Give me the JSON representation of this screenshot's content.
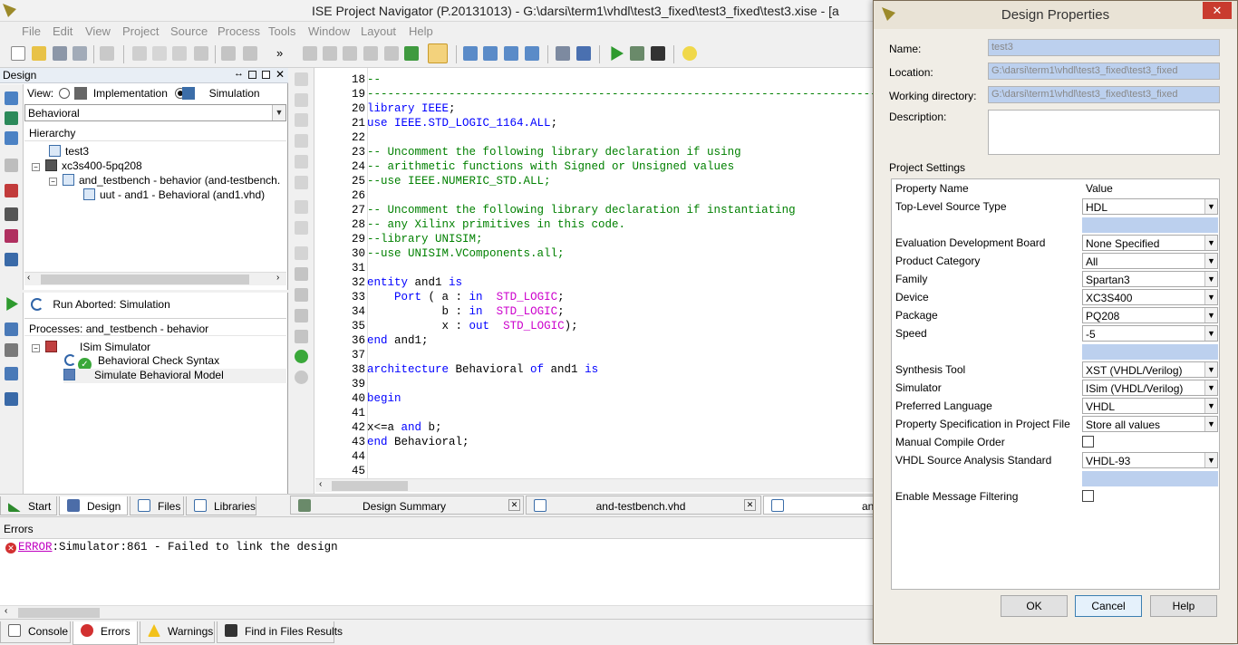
{
  "window": {
    "title": "ISE Project Navigator (P.20131013) - G:\\darsi\\term1\\vhdl\\test3_fixed\\test3_fixed\\test3.xise - [a"
  },
  "menu": [
    "File",
    "Edit",
    "View",
    "Project",
    "Source",
    "Process",
    "Tools",
    "Window",
    "Layout",
    "Help"
  ],
  "design_panel": {
    "title": "Design",
    "view_label": "View:",
    "impl_label": "Implementation",
    "sim_label": "Simulation",
    "selected_view": "Simulation",
    "behavior_combo": "Behavioral",
    "hierarchy_title": "Hierarchy",
    "tree": [
      "test3",
      "xc3s400-5pq208",
      "and_testbench - behavior (and-testbench.",
      "uut - and1 - Behavioral (and1.vhd)"
    ]
  },
  "process_panel": {
    "status": "Run Aborted: Simulation",
    "title": "Processes: and_testbench - behavior",
    "items": [
      "ISim Simulator",
      "Behavioral Check Syntax",
      "Simulate Behavioral Model"
    ]
  },
  "left_tabs": [
    "Start",
    "Design",
    "Files",
    "Libraries"
  ],
  "editor_tabs": [
    "Design Summary",
    "and-testbench.vhd",
    "an"
  ],
  "code_lines": [
    {
      "n": "18",
      "parts": [
        [
          "cm",
          "--"
        ]
      ]
    },
    {
      "n": "19",
      "parts": [
        [
          "cm",
          "----------------------------------------------------------------------------------------------"
        ]
      ]
    },
    {
      "n": "20",
      "parts": [
        [
          "kw",
          "library"
        ],
        [
          "tx",
          " "
        ],
        [
          "kw",
          "IEEE"
        ],
        [
          "tx",
          ";"
        ]
      ]
    },
    {
      "n": "21",
      "parts": [
        [
          "kw",
          "use"
        ],
        [
          "tx",
          " "
        ],
        [
          "kw",
          "IEEE.STD_LOGIC_1164.ALL"
        ],
        [
          "tx",
          ";"
        ]
      ]
    },
    {
      "n": "22",
      "parts": []
    },
    {
      "n": "23",
      "parts": [
        [
          "cm",
          "-- Uncomment the following library declaration if using"
        ]
      ]
    },
    {
      "n": "24",
      "parts": [
        [
          "cm",
          "-- arithmetic functions with Signed or Unsigned values"
        ]
      ]
    },
    {
      "n": "25",
      "parts": [
        [
          "cm",
          "--use IEEE.NUMERIC_STD.ALL;"
        ]
      ]
    },
    {
      "n": "26",
      "parts": []
    },
    {
      "n": "27",
      "parts": [
        [
          "cm",
          "-- Uncomment the following library declaration if instantiating"
        ]
      ]
    },
    {
      "n": "28",
      "parts": [
        [
          "cm",
          "-- any Xilinx primitives in this code."
        ]
      ]
    },
    {
      "n": "29",
      "parts": [
        [
          "cm",
          "--library UNISIM;"
        ]
      ]
    },
    {
      "n": "30",
      "parts": [
        [
          "cm",
          "--use UNISIM.VComponents.all;"
        ]
      ]
    },
    {
      "n": "31",
      "parts": []
    },
    {
      "n": "32",
      "parts": [
        [
          "kw",
          "entity"
        ],
        [
          "tx",
          " and1 "
        ],
        [
          "kw",
          "is"
        ]
      ]
    },
    {
      "n": "33",
      "parts": [
        [
          "tx",
          "    "
        ],
        [
          "kw",
          "Port"
        ],
        [
          "tx",
          " ( a : "
        ],
        [
          "kw",
          "in"
        ],
        [
          "tx",
          "  "
        ],
        [
          "ty",
          "STD_LOGIC"
        ],
        [
          "tx",
          ";"
        ]
      ]
    },
    {
      "n": "34",
      "parts": [
        [
          "tx",
          "           b : "
        ],
        [
          "kw",
          "in"
        ],
        [
          "tx",
          "  "
        ],
        [
          "ty",
          "STD_LOGIC"
        ],
        [
          "tx",
          ";"
        ]
      ]
    },
    {
      "n": "35",
      "parts": [
        [
          "tx",
          "           x : "
        ],
        [
          "kw",
          "out"
        ],
        [
          "tx",
          "  "
        ],
        [
          "ty",
          "STD_LOGIC"
        ],
        [
          "tx",
          ");"
        ]
      ]
    },
    {
      "n": "36",
      "parts": [
        [
          "kw",
          "end"
        ],
        [
          "tx",
          " and1;"
        ]
      ]
    },
    {
      "n": "37",
      "parts": []
    },
    {
      "n": "38",
      "parts": [
        [
          "kw",
          "architecture"
        ],
        [
          "tx",
          " Behavioral "
        ],
        [
          "kw",
          "of"
        ],
        [
          "tx",
          " and1 "
        ],
        [
          "kw",
          "is"
        ]
      ]
    },
    {
      "n": "39",
      "parts": []
    },
    {
      "n": "40",
      "parts": [
        [
          "kw",
          "begin"
        ]
      ]
    },
    {
      "n": "41",
      "parts": []
    },
    {
      "n": "42",
      "parts": [
        [
          "tx",
          "x<=a "
        ],
        [
          "kw",
          "and"
        ],
        [
          "tx",
          " b;"
        ]
      ]
    },
    {
      "n": "43",
      "parts": [
        [
          "kw",
          "end"
        ],
        [
          "tx",
          " Behavioral;"
        ]
      ]
    },
    {
      "n": "44",
      "parts": []
    },
    {
      "n": "45",
      "parts": []
    }
  ],
  "errors_panel": {
    "title": "Errors",
    "error_word": "ERROR",
    "error_msg": ":Simulator:861 - Failed to link the design"
  },
  "bottom_tabs": [
    "Console",
    "Errors",
    "Warnings",
    "Find in Files Results"
  ],
  "dialog": {
    "title": "Design Properties",
    "close": "✕",
    "name_label": "Name:",
    "name_value": "test3",
    "location_label": "Location:",
    "location_value": "G:\\darsi\\term1\\vhdl\\test3_fixed\\test3_fixed",
    "workdir_label": "Working directory:",
    "workdir_value": "G:\\darsi\\term1\\vhdl\\test3_fixed\\test3_fixed",
    "desc_label": "Description:",
    "settings_label": "Project Settings",
    "col_name": "Property Name",
    "col_value": "Value",
    "props": [
      {
        "name": "Top-Level Source Type",
        "value": "HDL",
        "kind": "combo"
      },
      {
        "name": "",
        "value": "",
        "kind": "blue"
      },
      {
        "name": "Evaluation Development Board",
        "value": "None Specified",
        "kind": "combo"
      },
      {
        "name": "Product Category",
        "value": "All",
        "kind": "combo"
      },
      {
        "name": "Family",
        "value": "Spartan3",
        "kind": "combo"
      },
      {
        "name": "Device",
        "value": "XC3S400",
        "kind": "combo"
      },
      {
        "name": "Package",
        "value": "PQ208",
        "kind": "combo"
      },
      {
        "name": "Speed",
        "value": "-5",
        "kind": "combo"
      },
      {
        "name": "",
        "value": "",
        "kind": "blue"
      },
      {
        "name": "Synthesis Tool",
        "value": "XST (VHDL/Verilog)",
        "kind": "combo"
      },
      {
        "name": "Simulator",
        "value": "ISim (VHDL/Verilog)",
        "kind": "combo"
      },
      {
        "name": "Preferred Language",
        "value": "VHDL",
        "kind": "combo"
      },
      {
        "name": "Property Specification in Project File",
        "value": "Store all values",
        "kind": "combo"
      },
      {
        "name": "Manual Compile Order",
        "value": "",
        "kind": "check"
      },
      {
        "name": "VHDL Source Analysis Standard",
        "value": "VHDL-93",
        "kind": "combo"
      },
      {
        "name": "",
        "value": "",
        "kind": "blue"
      },
      {
        "name": "Enable Message Filtering",
        "value": "",
        "kind": "check"
      }
    ],
    "ok": "OK",
    "cancel": "Cancel",
    "help": "Help"
  }
}
